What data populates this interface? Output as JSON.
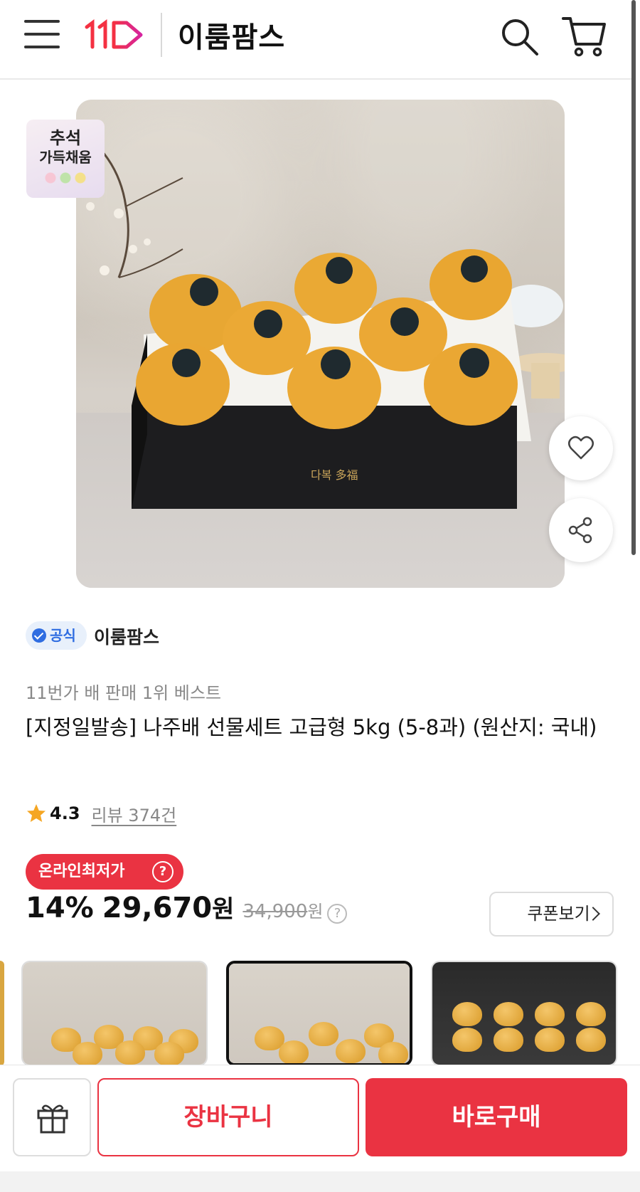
{
  "header": {
    "logo_text": "11",
    "store_title": "이룸팜스"
  },
  "hero": {
    "badge_line1": "추석",
    "badge_line2": "가득채움",
    "box_text": "다복 多福"
  },
  "seller": {
    "official_label": "공식",
    "name": "이룸팜스"
  },
  "product": {
    "rank_text": "11번가 배 판매 1위 베스트",
    "title": "[지정일발송] 나주배 선물세트 고급형 5kg (5-8과) (원산지: 국내)",
    "rating": "4.3",
    "review_link": "리뷰 374건"
  },
  "price": {
    "lowest_badge": "온라인최저가",
    "discount": "14%",
    "sale_price": "29,670",
    "currency": "원",
    "original_price": "34,900",
    "coupon_label": "쿠폰보기"
  },
  "bottom": {
    "cart_label": "장바구니",
    "buy_label": "바로구매"
  },
  "colors": {
    "accent": "#ea3342",
    "official_blue": "#2f6de1",
    "star": "#f5a623"
  }
}
